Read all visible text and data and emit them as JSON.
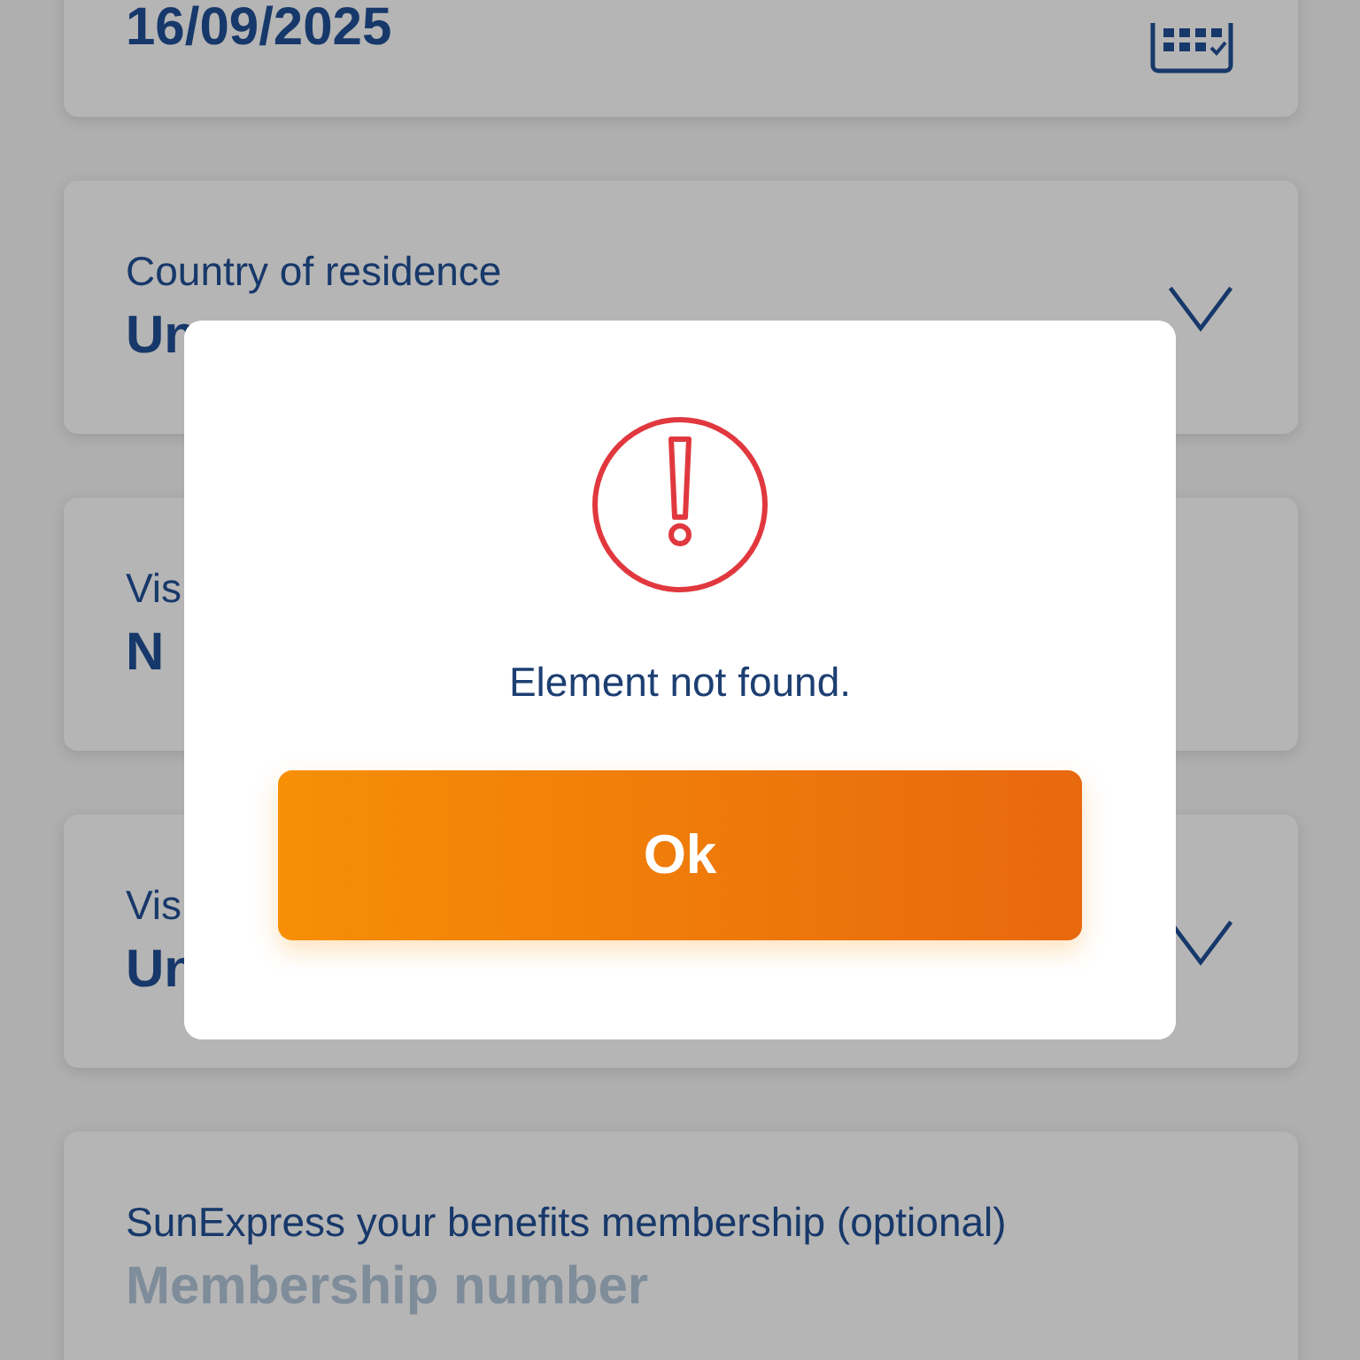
{
  "form": {
    "fields": [
      {
        "kind": "date",
        "value": "16/09/2025"
      },
      {
        "kind": "select",
        "label": "Country of residence",
        "value": "Un"
      },
      {
        "kind": "text",
        "label": "Vis",
        "value": "N"
      },
      {
        "kind": "select",
        "label": "Vis",
        "value": "Un"
      },
      {
        "kind": "input",
        "label": "SunExpress your benefits membership (optional)",
        "placeholder": "Membership number"
      }
    ]
  },
  "dialog": {
    "message": "Element not found.",
    "button": "Ok"
  }
}
